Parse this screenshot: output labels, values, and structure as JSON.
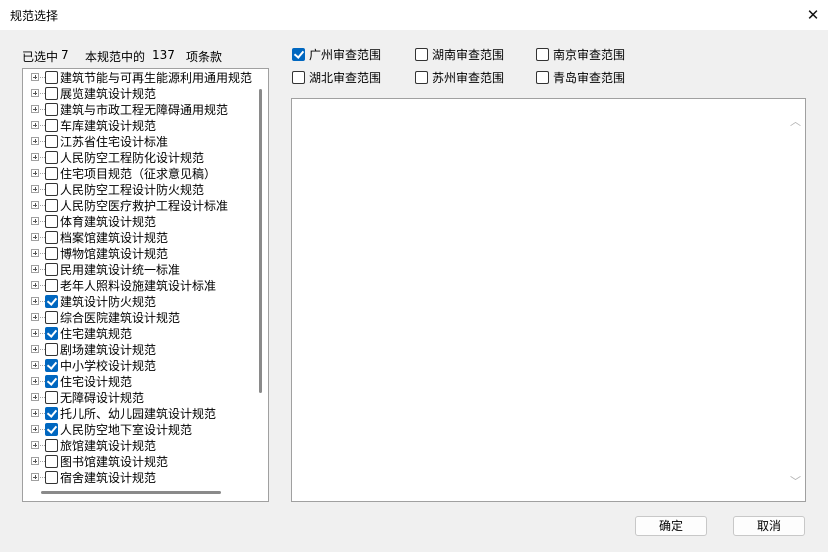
{
  "window": {
    "title": "规范选择",
    "close_glyph": "✕"
  },
  "summary": {
    "selected_prefix": "已选中",
    "selected_count": "7",
    "total_prefix": "本规范中的",
    "total_count": "137",
    "total_suffix": "项条款"
  },
  "tree": {
    "items": [
      {
        "label": "建筑节能与可再生能源利用通用规范",
        "checked": false
      },
      {
        "label": "展览建筑设计规范",
        "checked": false
      },
      {
        "label": "建筑与市政工程无障碍通用规范",
        "checked": false
      },
      {
        "label": "车库建筑设计规范",
        "checked": false
      },
      {
        "label": "江苏省住宅设计标准",
        "checked": false
      },
      {
        "label": "人民防空工程防化设计规范",
        "checked": false
      },
      {
        "label": "住宅项目规范（征求意见稿）",
        "checked": false
      },
      {
        "label": "人民防空工程设计防火规范",
        "checked": false
      },
      {
        "label": "人民防空医疗救护工程设计标准",
        "checked": false
      },
      {
        "label": "体育建筑设计规范",
        "checked": false
      },
      {
        "label": "档案馆建筑设计规范",
        "checked": false
      },
      {
        "label": "博物馆建筑设计规范",
        "checked": false
      },
      {
        "label": "民用建筑设计统一标准",
        "checked": false
      },
      {
        "label": "老年人照料设施建筑设计标准",
        "checked": false
      },
      {
        "label": "建筑设计防火规范",
        "checked": true
      },
      {
        "label": "综合医院建筑设计规范",
        "checked": false
      },
      {
        "label": "住宅建筑规范",
        "checked": true
      },
      {
        "label": "剧场建筑设计规范",
        "checked": false
      },
      {
        "label": "中小学校设计规范",
        "checked": true
      },
      {
        "label": "住宅设计规范",
        "checked": true
      },
      {
        "label": "无障碍设计规范",
        "checked": false
      },
      {
        "label": "托儿所、幼儿园建筑设计规范",
        "checked": true
      },
      {
        "label": "人民防空地下室设计规范",
        "checked": true
      },
      {
        "label": "旅馆建筑设计规范",
        "checked": false
      },
      {
        "label": "图书馆建筑设计规范",
        "checked": false
      },
      {
        "label": "宿舍建筑设计规范",
        "checked": false
      }
    ]
  },
  "scopes": [
    {
      "label": "广州审查范围",
      "checked": true
    },
    {
      "label": "湖南审查范围",
      "checked": false
    },
    {
      "label": "南京审查范围",
      "checked": false
    },
    {
      "label": "湖北审查范围",
      "checked": false
    },
    {
      "label": "苏州审查范围",
      "checked": false
    },
    {
      "label": "青岛审查范围",
      "checked": false
    }
  ],
  "buttons": {
    "ok": "确定",
    "cancel": "取消"
  },
  "icons": {
    "scroll_up": "up-arrow-icon",
    "scroll_down": "down-arrow-icon"
  },
  "colors": {
    "accent": "#0067c0"
  }
}
